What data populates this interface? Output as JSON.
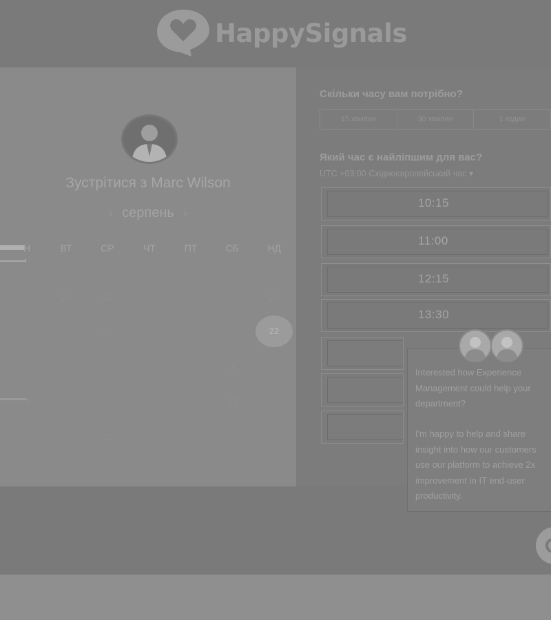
{
  "brand": {
    "name": "HappySignals"
  },
  "booking": {
    "title": "Зустрітися з Marc Wilson",
    "month": "серпень",
    "weekdays": [
      "Н",
      "ВТ",
      "СР",
      "ЧТ",
      "ПТ",
      "СБ",
      "НД"
    ],
    "days": {
      "row1": [
        "20",
        "21",
        "28"
      ],
      "row2": [
        "15",
        "22"
      ],
      "row3": [
        "3"
      ],
      "row4": [
        "5",
        "12"
      ],
      "row5": [
        "11"
      ]
    },
    "selected_day": "22"
  },
  "duration": {
    "heading": "Скільки часу вам потрібно?",
    "options": [
      "15 хвилин",
      "30 хвилин",
      "1 годин"
    ]
  },
  "time": {
    "heading": "Який час є найліпшим для вас?",
    "timezone": "UTC +03:00 Східноєвропейський час",
    "slots": [
      "10:15",
      "11:00",
      "12:15",
      "13:30"
    ]
  },
  "chat": {
    "message1": "Interested how Experience Management could help your department?",
    "message2": "I'm happy to help and share insight into how our customers use our platform to achieve 2x improvement in IT end-user productivity."
  },
  "colors": {
    "brand": "#9a9a9a"
  }
}
